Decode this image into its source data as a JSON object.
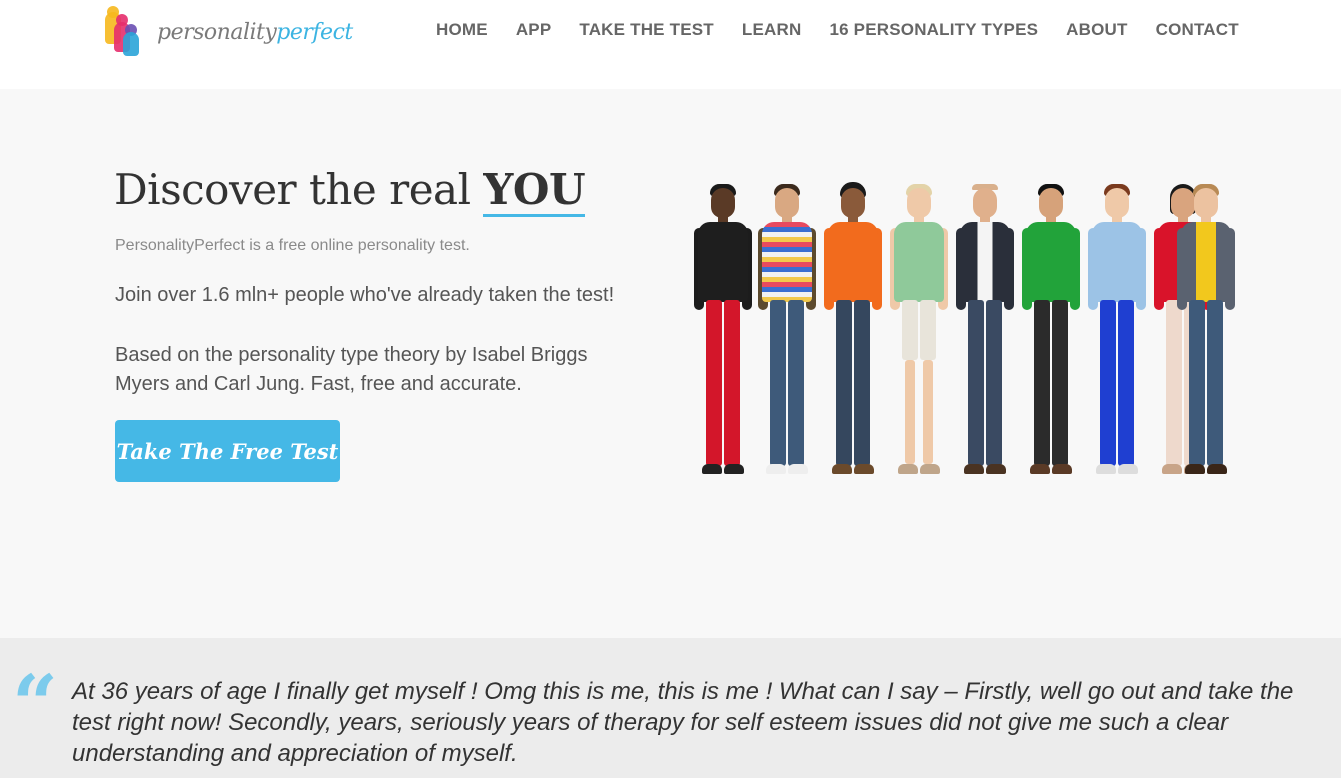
{
  "logo": {
    "word1": "personality",
    "word2": "perfect"
  },
  "nav": {
    "items": [
      {
        "label": "HOME"
      },
      {
        "label": "APP"
      },
      {
        "label": "TAKE THE TEST"
      },
      {
        "label": "LEARN"
      },
      {
        "label": "16 PERSONALITY TYPES"
      },
      {
        "label": "ABOUT"
      },
      {
        "label": "CONTACT"
      }
    ]
  },
  "hero": {
    "title_prefix": "Discover the real ",
    "title_emphasis": "YOU",
    "subtitle": "PersonalityPerfect is a free online personality test.",
    "join_text": "Join over 1.6 mln+ people who've already taken the test!",
    "based_text": "Based on the personality type theory by Isabel Briggs Myers and Carl Jung. Fast, free and accurate.",
    "cta_label": "Take The Free Test"
  },
  "testimonial": {
    "quote_mark": "“",
    "text": "At 36 years of age I finally get myself ! Omg this is me, this is me ! What can I say – Firstly, well go out and take the test right now! Secondly, years, seriously years of therapy for self esteem issues did not give me such a clear understanding and appreciation of myself."
  },
  "colors": {
    "accent": "#45b8e6",
    "hero_bg": "#f8f8f8",
    "testimonial_bg": "#ececec",
    "nav_text": "#666666"
  }
}
